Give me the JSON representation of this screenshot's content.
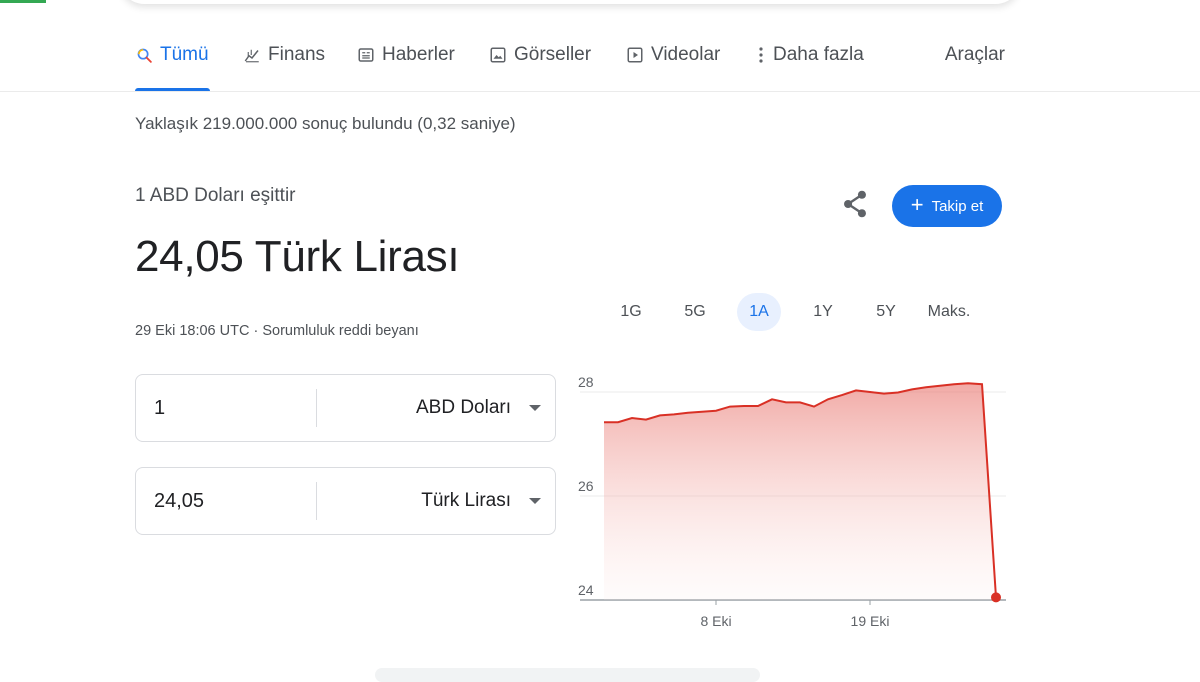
{
  "tabs": [
    {
      "label": "Tümü",
      "icon": "search-icon",
      "active": true
    },
    {
      "label": "Finans",
      "icon": "finance-icon",
      "active": false
    },
    {
      "label": "Haberler",
      "icon": "news-icon",
      "active": false
    },
    {
      "label": "Görseller",
      "icon": "images-icon",
      "active": false
    },
    {
      "label": "Videolar",
      "icon": "video-icon",
      "active": false
    },
    {
      "label": "Daha fazla",
      "icon": "more-vert-icon",
      "active": false
    }
  ],
  "tools_label": "Araçlar",
  "result_stats": "Yaklaşık 219.000.000 sonuç bulundu (0,32 saniye)",
  "converter": {
    "equals_label": "1 ABD Doları eşittir",
    "big_value": "24,05 Türk Lirası",
    "timestamp": "29 Eki 18:06 UTC",
    "separator": "·",
    "disclaimer": "Sorumluluk reddi beyanı",
    "follow_label": "Takip et",
    "from": {
      "amount": "1",
      "currency": "ABD Doları"
    },
    "to": {
      "amount": "24,05",
      "currency": "Türk Lirası"
    }
  },
  "ranges": [
    {
      "label": "1G",
      "active": false
    },
    {
      "label": "5G",
      "active": false
    },
    {
      "label": "1A",
      "active": true
    },
    {
      "label": "1Y",
      "active": false
    },
    {
      "label": "5Y",
      "active": false
    },
    {
      "label": "Maks.",
      "active": false
    }
  ],
  "colors": {
    "accent": "#1a73e8",
    "chart_line": "#d93025"
  },
  "chart_data": {
    "type": "area",
    "ylim": [
      24,
      28
    ],
    "yticks": [
      "28",
      "26",
      "24"
    ],
    "x_tick_labels": [
      "8 Eki",
      "19 Eki"
    ],
    "x_tick_positions": [
      9,
      20
    ],
    "xlim": [
      1,
      29
    ],
    "series": [
      {
        "values": [
          [
            1,
            27.42
          ],
          [
            2,
            27.42
          ],
          [
            3,
            27.5
          ],
          [
            4,
            27.47
          ],
          [
            5,
            27.55
          ],
          [
            6,
            27.57
          ],
          [
            7,
            27.6
          ],
          [
            8,
            27.62
          ],
          [
            9,
            27.64
          ],
          [
            10,
            27.72
          ],
          [
            11,
            27.73
          ],
          [
            12,
            27.73
          ],
          [
            13,
            27.86
          ],
          [
            14,
            27.8
          ],
          [
            15,
            27.8
          ],
          [
            16,
            27.72
          ],
          [
            17,
            27.86
          ],
          [
            18,
            27.94
          ],
          [
            19,
            28.03
          ],
          [
            20,
            28.0
          ],
          [
            21,
            27.97
          ],
          [
            22,
            27.99
          ],
          [
            23,
            28.05
          ],
          [
            24,
            28.09
          ],
          [
            25,
            28.12
          ],
          [
            26,
            28.15
          ],
          [
            27,
            28.17
          ],
          [
            28,
            28.15
          ],
          [
            29,
            24.05
          ]
        ]
      }
    ]
  }
}
